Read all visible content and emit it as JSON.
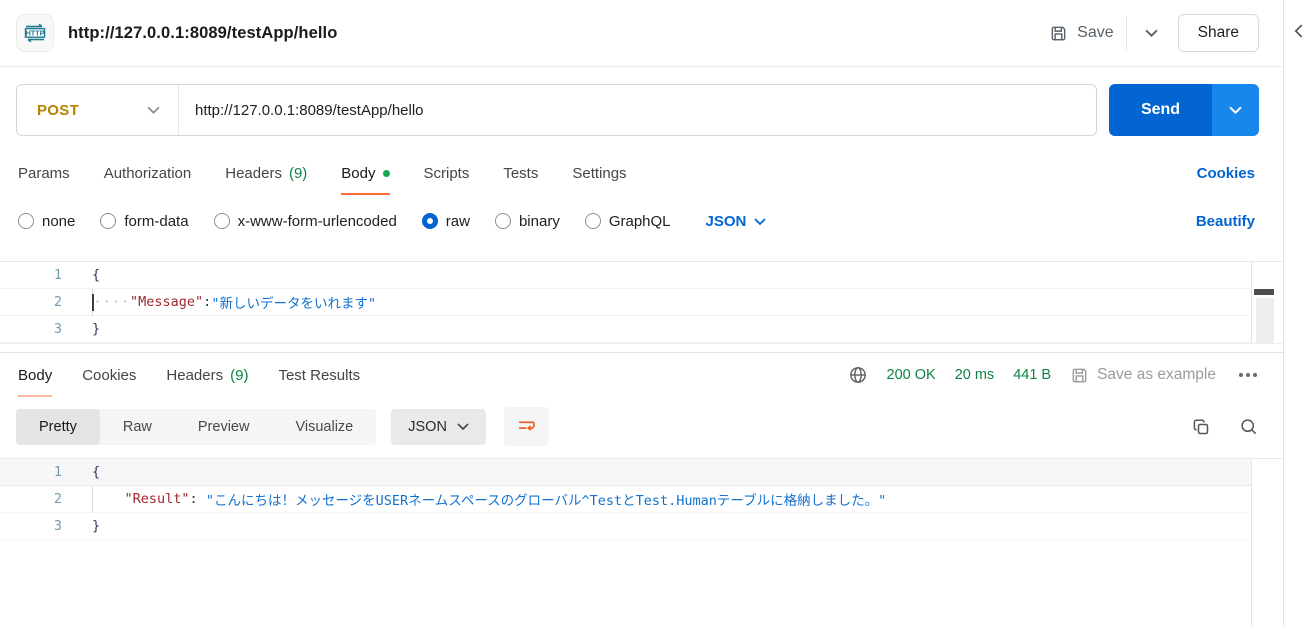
{
  "colors": {
    "accent_orange": "#FF6C37",
    "link_blue": "#0265D2",
    "success_green": "#0E8345",
    "method_post_amber": "#B68300",
    "send_button_blue": "#0265D2"
  },
  "header": {
    "request_type_badge": "HTTP",
    "title": "http://127.0.0.1:8089/testApp/hello",
    "save_label": "Save",
    "share_label": "Share"
  },
  "request": {
    "method": "POST",
    "url": "http://127.0.0.1:8089/testApp/hello",
    "send_label": "Send",
    "tabs": [
      {
        "label": "Params"
      },
      {
        "label": "Authorization"
      },
      {
        "label": "Headers",
        "count": "(9)"
      },
      {
        "label": "Body"
      },
      {
        "label": "Scripts"
      },
      {
        "label": "Tests"
      },
      {
        "label": "Settings"
      }
    ],
    "cookies_link": "Cookies",
    "body_modes": [
      "none",
      "form-data",
      "x-www-form-urlencoded",
      "raw",
      "binary",
      "GraphQL"
    ],
    "selected_mode": "raw",
    "language": "JSON",
    "beautify_link": "Beautify",
    "editor": {
      "line_numbers": [
        "1",
        "2",
        "3"
      ],
      "line1": "{",
      "line2_whitespace": "····",
      "line2_key": "\"Message\"",
      "line2_colon": ":",
      "line2_value": "\"新しいデータをいれます\"",
      "line3": "}"
    }
  },
  "response": {
    "tabs": [
      {
        "label": "Body"
      },
      {
        "label": "Cookies"
      },
      {
        "label": "Headers",
        "count": "(9)"
      },
      {
        "label": "Test Results"
      }
    ],
    "status": "200 OK",
    "time": "20 ms",
    "size": "441 B",
    "save_as_example": "Save as example",
    "view_tabs": [
      "Pretty",
      "Raw",
      "Preview",
      "Visualize"
    ],
    "selected_view": "Pretty",
    "language": "JSON",
    "editor": {
      "line_numbers": [
        "1",
        "2",
        "3"
      ],
      "line1": "{",
      "line2_indent": "    ",
      "line2_key": "\"Result\"",
      "line2_colon": ": ",
      "line2_value": "\"こんにちは！メッセージをUSERネームスペースのグローバル^TestとTest.Humanテーブルに格納しました。\"",
      "line3": "}"
    }
  }
}
